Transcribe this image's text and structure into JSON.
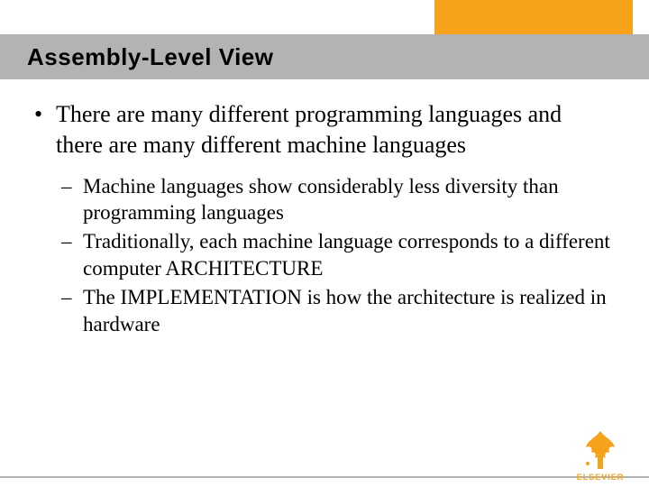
{
  "header": {
    "title": "Assembly-Level View"
  },
  "content": {
    "bullet1": "There are many different programming languages and there are many different machine languages",
    "sub1": "Machine languages show considerably less diversity than programming languages",
    "sub2": "Traditionally, each machine language corresponds to a different computer ARCHITECTURE",
    "sub3": "The IMPLEMENTATION is how the architecture is realized in hardware"
  },
  "footer": {
    "publisher": "ELSEVIER"
  },
  "colors": {
    "accent": "#f6a21a",
    "titlebar": "#b3b3b3"
  }
}
